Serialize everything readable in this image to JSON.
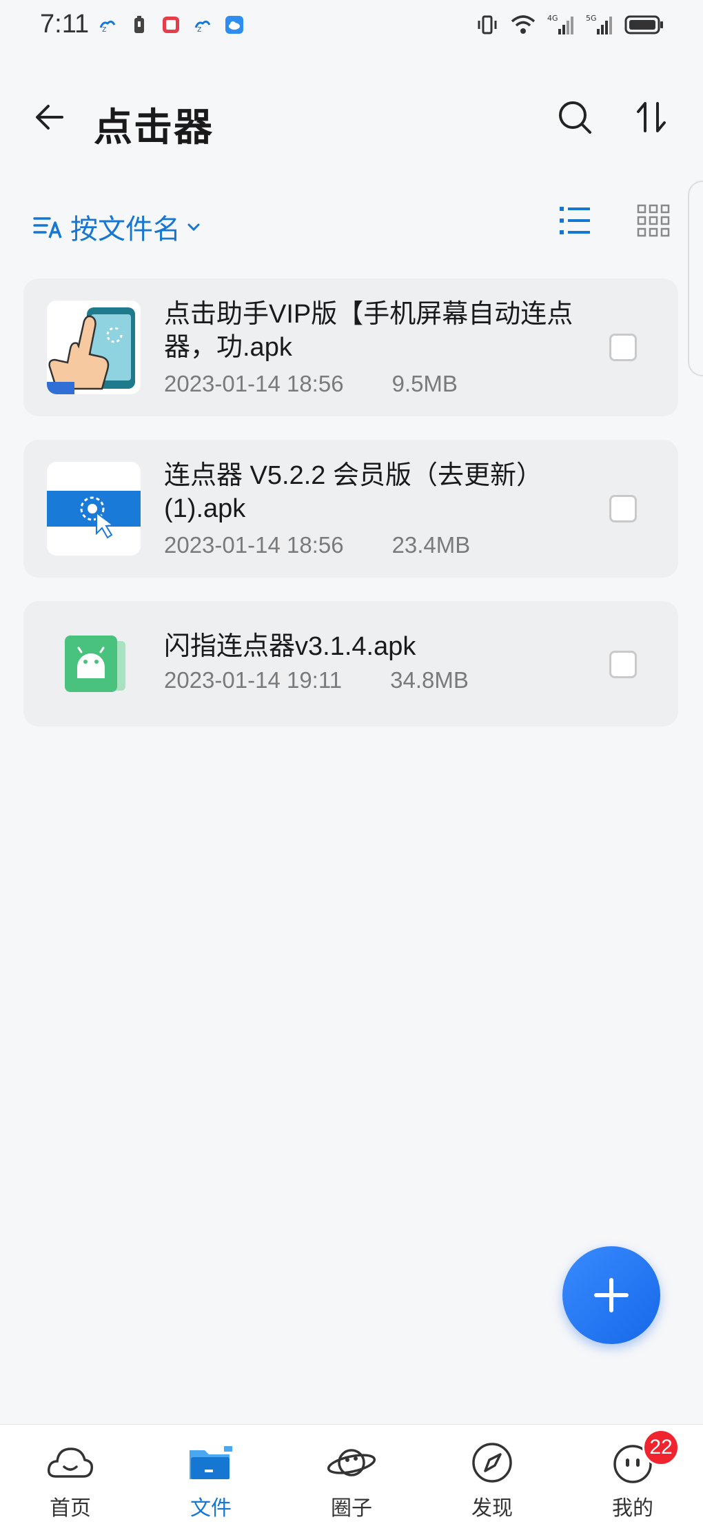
{
  "status_bar": {
    "time": "7:11",
    "left_icons": [
      "cloud-app-icon",
      "battery-saver-icon",
      "red-app-icon",
      "cloud-app-icon",
      "cloud-drive-icon"
    ],
    "right_icons": [
      "vibrate-icon",
      "wifi-icon",
      "signal-4g-icon",
      "signal-5g-icon",
      "battery-icon"
    ],
    "signal_1": "4G",
    "signal_2": "5G"
  },
  "header": {
    "title": "点击器",
    "back_icon": "back-arrow-icon",
    "search_icon": "search-icon",
    "sort_icon": "sort-icon"
  },
  "filter": {
    "sort_label": "按文件名",
    "sort_icon": "sort-text-icon",
    "list_view_icon": "list-view-icon",
    "grid_view_icon": "grid-view-icon"
  },
  "files": [
    {
      "name": "点击助手VIP版【手机屏幕自动连点器，功.apk",
      "date": "2023-01-14 18:56",
      "size": "9.5MB",
      "icon": "tap-assistant-app-icon"
    },
    {
      "name": "连点器 V5.2.2 会员版（去更新）(1).apk",
      "date": "2023-01-14 18:56",
      "size": "23.4MB",
      "icon": "auto-clicker-app-icon"
    },
    {
      "name": "闪指连点器v3.1.4.apk",
      "date": "2023-01-14 19:11",
      "size": "34.8MB",
      "icon": "android-apk-icon"
    }
  ],
  "fab": {
    "icon": "plus-icon"
  },
  "bottom_nav": {
    "items": [
      {
        "label": "首页",
        "icon": "home-cloud-icon",
        "active": false
      },
      {
        "label": "文件",
        "icon": "folder-icon",
        "active": true
      },
      {
        "label": "圈子",
        "icon": "planet-icon",
        "active": false
      },
      {
        "label": "发现",
        "icon": "compass-icon",
        "active": false
      },
      {
        "label": "我的",
        "icon": "profile-face-icon",
        "active": false,
        "badge": "22"
      }
    ]
  },
  "colors": {
    "accent": "#1677d2",
    "fab": "#1668e8",
    "badge": "#f0242e",
    "background": "#f6f7f9"
  }
}
